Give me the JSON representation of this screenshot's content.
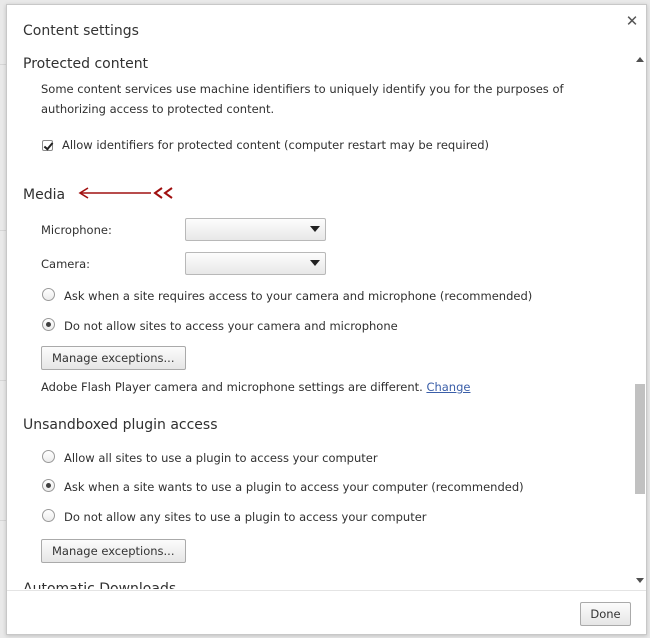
{
  "dialog": {
    "title": "Content settings",
    "done_label": "Done"
  },
  "protected_content": {
    "heading": "Protected content",
    "description": "Some content services use machine identifiers to uniquely identify you for the purposes of authorizing access to protected content.",
    "allow_checkbox_label": "Allow identifiers for protected content (computer restart may be required)",
    "allow_checked": true
  },
  "media": {
    "heading": "Media",
    "annotation_arrow_color": "#a01010",
    "microphone_label": "Microphone:",
    "microphone_value": "",
    "camera_label": "Camera:",
    "camera_value": "",
    "options": [
      {
        "label": "Ask when a site requires access to your camera and microphone (recommended)",
        "checked": false
      },
      {
        "label": "Do not allow sites to access your camera and microphone",
        "checked": true
      }
    ],
    "manage_label": "Manage exceptions...",
    "flash_note": "Adobe Flash Player camera and microphone settings are different.",
    "flash_link": "Change"
  },
  "unsandboxed": {
    "heading": "Unsandboxed plugin access",
    "options": [
      {
        "label": "Allow all sites to use a plugin to access your computer",
        "checked": false
      },
      {
        "label": "Ask when a site wants to use a plugin to access your computer (recommended)",
        "checked": true
      },
      {
        "label": "Do not allow any sites to use a plugin to access your computer",
        "checked": false
      }
    ],
    "manage_label": "Manage exceptions..."
  },
  "next_section": {
    "heading_partial": "Automatic Downloads"
  },
  "colors": {
    "link": "#3a5ea8",
    "scroll_thumb": "#c1c1c1"
  }
}
